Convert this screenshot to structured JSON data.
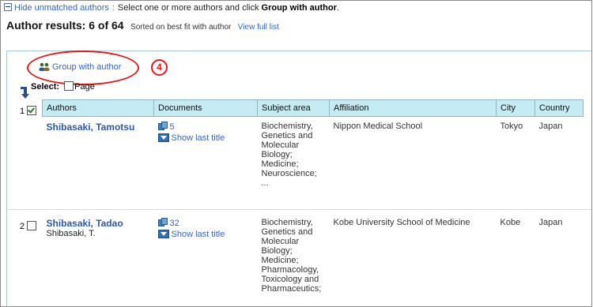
{
  "topline": {
    "hide_link": "Hide unmatched authors",
    "instruction_prefix": "Select one or more authors and click",
    "instruction_bold": "Group with author"
  },
  "results": {
    "heading": "Author results: 6 of 64",
    "sorted_text": "Sorted on best fit with author",
    "view_full": "View full list"
  },
  "group": {
    "label": "Group with author",
    "callout_number": "4"
  },
  "select": {
    "label": "Select:",
    "page_label": "Page"
  },
  "table": {
    "headers": [
      "Authors",
      "Documents",
      "Subject area",
      "Affiliation",
      "City",
      "Country"
    ],
    "rows": [
      {
        "num": "1",
        "checked": true,
        "name": "Shibasaki, Tamotsu",
        "variant": "",
        "docs": "5",
        "show_last": "Show last title",
        "subject": "Biochemistry,\nGenetics and\nMolecular\nBiology;\nMedicine;\nNeuroscience;\n...",
        "affiliation": "Nippon Medical School",
        "city": "Tokyo",
        "country": "Japan"
      },
      {
        "num": "2",
        "checked": false,
        "name": "Shibasaki, Tadao",
        "variant": "Shibasaki, T.",
        "docs": "32",
        "show_last": "Show last title",
        "subject": "Biochemistry,\nGenetics and\nMolecular\nBiology;\nMedicine;\nPharmacology,\nToxicology and\nPharmaceutics;",
        "affiliation": "Kobe University School of Medicine",
        "city": "Kobe",
        "country": "Japan"
      }
    ]
  },
  "colors": {
    "link": "#3366cc",
    "header_bg": "#c5ebf3",
    "callout": "#e21b1b"
  }
}
